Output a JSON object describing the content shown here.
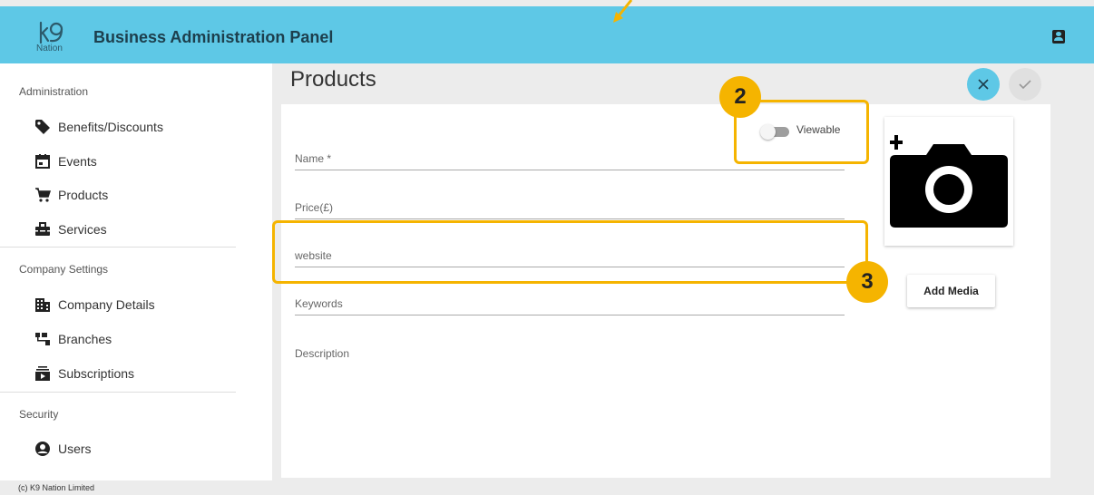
{
  "header": {
    "logo_text": "Nation",
    "title": "Business Administration Panel",
    "account_icon": "account-box-icon",
    "bg_color": "#5ec8e6"
  },
  "sidebar": {
    "sections": [
      {
        "title": "Administration",
        "items": [
          {
            "label": "Benefits/Discounts",
            "icon": "tag-icon"
          },
          {
            "label": "Events",
            "icon": "calendar-icon"
          },
          {
            "label": "Products",
            "icon": "cart-icon"
          },
          {
            "label": "Services",
            "icon": "toolbox-icon"
          }
        ]
      },
      {
        "title": "Company Settings",
        "items": [
          {
            "label": "Company Details",
            "icon": "building-icon"
          },
          {
            "label": "Branches",
            "icon": "sitemap-icon"
          },
          {
            "label": "Subscriptions",
            "icon": "subscriptions-icon"
          }
        ]
      },
      {
        "title": "Security",
        "items": [
          {
            "label": "Users",
            "icon": "user-circle-icon"
          }
        ]
      }
    ]
  },
  "main": {
    "title": "Products",
    "close_icon": "close-icon",
    "confirm_icon": "check-icon",
    "viewable": {
      "label": "Viewable",
      "on": false
    },
    "fields": {
      "name": "Name *",
      "price": "Price(£)",
      "website": "website",
      "keywords": "Keywords",
      "description": "Description"
    },
    "media_icon": "add-photo-camera-icon",
    "add_media_label": "Add Media"
  },
  "annotations": {
    "badge_2": "2",
    "badge_3": "3",
    "highlight_color": "#f5b400"
  },
  "footer": {
    "text": "(c) K9 Nation Limited"
  }
}
